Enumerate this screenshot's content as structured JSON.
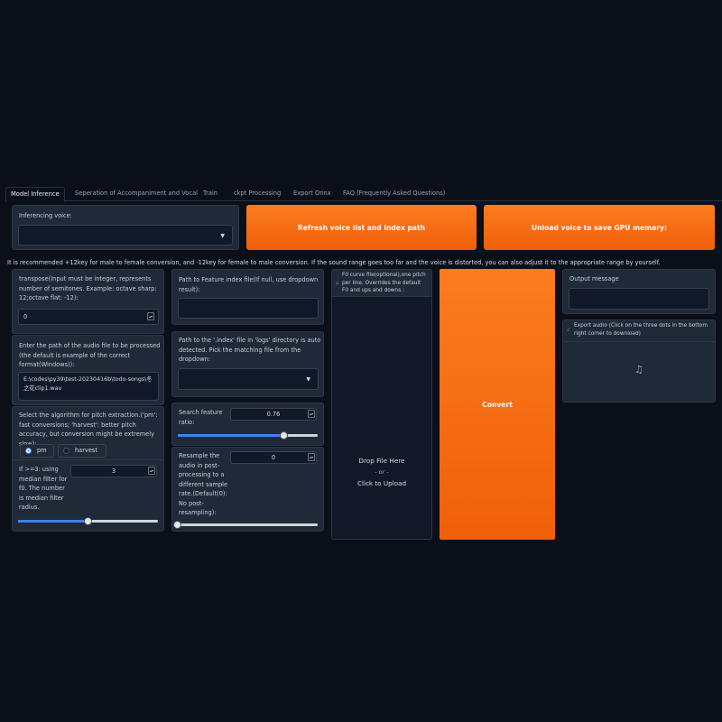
{
  "tabs": [
    {
      "label": "Model Inference",
      "selected": true
    },
    {
      "label": "Seperation of Accompaniment and Vocal",
      "selected": false
    },
    {
      "label": "Train",
      "selected": false
    },
    {
      "label": "ckpt Processing",
      "selected": false
    },
    {
      "label": "Export Onnx",
      "selected": false
    },
    {
      "label": "FAQ (Frequently Asked Questions)",
      "selected": false
    }
  ],
  "voice": {
    "label": "Inferencing voice:",
    "value": ""
  },
  "buttons": {
    "refresh": "Refresh voice list and index path",
    "unload": "Unload voice to save GPU memory:",
    "convert": "Convert"
  },
  "note": "It is recommended +12key for male to female conversion, and -12key for female to male conversion. If the sound range goes too far and the voice is distorted, you can also adjust it to the appropriate range by yourself.",
  "transpose": {
    "label": "transpose(Input must be integer, represents number of semitones. Example: octave sharp: 12;octave flat: -12):",
    "value": "0"
  },
  "audio_path": {
    "label": "Enter the path of the audio file to be processed (the default is example of the correct format(Windows)):",
    "value": "E:\\codes\\py39\\test-20230416b\\todo-songs\\冬之花clip1.wav"
  },
  "f0_method": {
    "label": "Select the algorithm for pitch extraction.('pm': fast conversions; 'harvest': better pitch accuracy, but conversion might be extremely slow):",
    "options": [
      "pm",
      "harvest"
    ],
    "selected": "pm"
  },
  "filter_radius": {
    "label": "If >=3: using median filter for f0. The number is median filter radius.",
    "value": "3",
    "fraction": 0.5
  },
  "feature_index": {
    "label": "Path to Feature index file(If null, use dropdown result):",
    "value": ""
  },
  "index_dropdown": {
    "label": "Path to the '.index' file in 'logs' directory is auto detected. Pick the matching file from the dropdown:",
    "value": ""
  },
  "search_ratio": {
    "label": "Search feature ratio:",
    "value": "0.76",
    "fraction": 0.76
  },
  "resample": {
    "label": "Resample the audio in post-processing to a different sample rate.(Default(0): No post-resampling):",
    "value": "0",
    "fraction": 0.0
  },
  "f0_file": {
    "label": "F0 curve file(optional),one pitch per line. Overrides the default F0 and ups and downs :",
    "drop_text": "Drop File Here",
    "or_text": "- or -",
    "click_text": "Click to Upload"
  },
  "output": {
    "label": "Output message",
    "value": ""
  },
  "export_audio": {
    "label": "Export audio (Click on the three dots in the bottom right corner to download)"
  },
  "icons": {
    "dropdown": "chevron-down-icon",
    "upload": "file-icon",
    "audio": "music-note-icon"
  },
  "colors": {
    "background": "#0b0f19",
    "panel": "#1f2937",
    "accent": "#f97316",
    "slider": "#3b82f6"
  }
}
